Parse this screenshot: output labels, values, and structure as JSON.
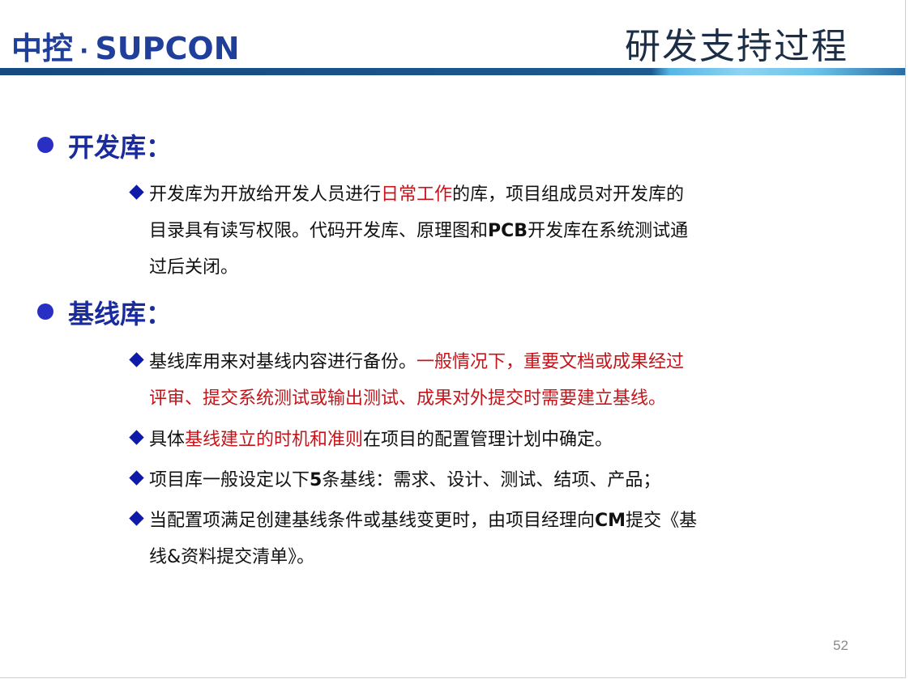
{
  "header": {
    "logo_cn": "中控",
    "logo_dot": "·",
    "logo_en": "SUPCON",
    "title": "研发支持过程"
  },
  "sections": [
    {
      "heading": "开发库：",
      "items": [
        {
          "l1a": "开发库为开放给开发人员进行",
          "l1b": "日常工作",
          "l1c": "的库，项目组成员对开发库的",
          "l2a": "目录具有读写权限。代码开发库、原理图和",
          "l2b": "PCB",
          "l2c": "开发库在系统测试通",
          "l3": "过后关闭。"
        }
      ]
    },
    {
      "heading": "基线库：",
      "items": [
        {
          "l1a": "基线库用来对基线内容进行备份。",
          "l1b": "一般情况下，重要文档或成果经过",
          "l2": "评审、提交系统测试或输出测试、成果对外提交时需要建立基线。"
        },
        {
          "a": "具体",
          "b": "基线建立的时机和准则",
          "c": "在项目的配置管理计划中确定。"
        },
        {
          "a": "项目库一般设定以下",
          "b": "5",
          "c": "条基线：需求、设计、测试、结项、产品；"
        },
        {
          "l1a": "当配置项满足创建基线条件或基线变更时，由项目经理向",
          "l1b": "CM",
          "l1c": "提交《基",
          "l2": "线&资料提交清单》。"
        }
      ]
    }
  ],
  "page_number": "52",
  "colors": {
    "heading": "#1a2b9e",
    "highlight": "#c4141a",
    "logo": "#1f3f9a"
  }
}
